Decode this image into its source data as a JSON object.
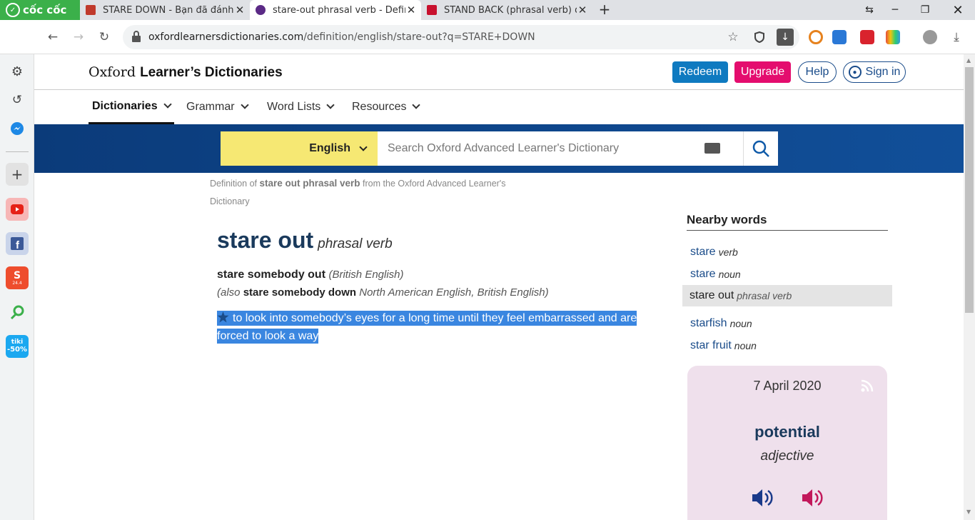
{
  "browser": {
    "brand": "cốc cốc",
    "tabs": [
      {
        "title": "STARE DOWN - Bạn đã đánh",
        "active": false
      },
      {
        "title": "stare-out phrasal verb - Defin",
        "active": true
      },
      {
        "title": "STAND BACK (phrasal verb) d",
        "active": false
      }
    ],
    "url_host": "oxfordlearnersdictionaries.com",
    "url_path": "/definition/english/stare-out?q=STARE+DOWN"
  },
  "sidebar": {
    "tiki_label": "tiki",
    "tiki_discount": "-50%",
    "shopee_badge": "24.4"
  },
  "site": {
    "logo_oxford": "Oxford",
    "logo_rest": "Learner’s Dictionaries",
    "redeem": "Redeem",
    "upgrade": "Upgrade",
    "help": "Help",
    "signin": "Sign in",
    "nav": [
      "Dictionaries",
      "Grammar",
      "Word Lists",
      "Resources"
    ],
    "language": "English",
    "search_placeholder": "Search Oxford Advanced Learner's Dictionary"
  },
  "entry": {
    "crumb_pre": "Definition of",
    "crumb_term": "stare out phrasal verb",
    "crumb_post": "from the Oxford Advanced Learner's Dictionary",
    "headword": "stare out",
    "pos": "phrasal verb",
    "form": "stare somebody out",
    "form_variety": "(British English)",
    "also_pre": "(also",
    "also_form": "stare somebody down",
    "also_variety": "North American English, British English)",
    "definition": "to look into somebody’s eyes for a long time until they feel embarrassed and are forced to look a way"
  },
  "nearby": {
    "title": "Nearby words",
    "items": [
      {
        "word": "stare",
        "pos": "verb"
      },
      {
        "word": "stare",
        "pos": "noun"
      },
      {
        "word": "stare out",
        "pos": "phrasal verb"
      },
      {
        "word": "starfish",
        "pos": "noun"
      },
      {
        "word": "star fruit",
        "pos": "noun"
      }
    ]
  },
  "wotd": {
    "date": "7 April 2020",
    "word": "potential",
    "pos": "adjective"
  },
  "colors": {
    "oxford_blue": "#0b3b7a",
    "selector_yellow": "#f6e873",
    "upgrade_pink": "#e40d6e",
    "redeem_blue": "#0f7ac0",
    "wotd_bg": "#efe0ec",
    "selection": "#3a86e0"
  }
}
